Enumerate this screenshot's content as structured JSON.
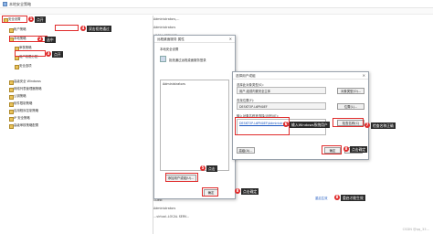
{
  "window": {
    "title": "本地安全策略"
  },
  "tree": {
    "items": [
      "安全设置",
      "帐户策略",
      "本地策略",
      "审核策略",
      "用户权限分配",
      "安全选项",
      "高级安全 Windows",
      "网络列表管理器策略",
      "公钥策略",
      "软件限制策略",
      "应用程序控制策略",
      "IP 安全策略",
      "高级审核策略配置"
    ]
  },
  "policy": {
    "rows": [
      {
        "name": "安全设置",
        "value": "Administrators,..."
      },
      {
        "name": "…",
        "value": "Administrators"
      },
      {
        "name": "…",
        "value": "LOCAL SERVICE,..."
      },
      {
        "name": "…",
        "value": "Administrators,Users"
      },
      {
        "name": "…",
        "value": "Everyone,Administrators"
      },
      {
        "name": "…",
        "value": "LOCAL SERVICE,..."
      },
      {
        "name": "…",
        "value": "Administrators"
      },
      {
        "name": "…",
        "value": "Guest"
      },
      {
        "name": "…",
        "value": "Administrators"
      },
      {
        "name": "…",
        "value": "LOCAL SERVICE,..."
      },
      {
        "name": "…",
        "value": "Administrators"
      },
      {
        "name": "…",
        "value": "Administrators,..."
      },
      {
        "name": "…",
        "value": "LOCAL SERVICE"
      },
      {
        "name": "…",
        "value": "Everyone,Administrators"
      },
      {
        "name": "…",
        "value": "Administrators"
      },
      {
        "name": "…",
        "value": "Guest"
      },
      {
        "name": "…",
        "value": "Administrators"
      },
      {
        "name": "…",
        "value": "LOCAL SERVICE,NE..."
      },
      {
        "name": "…",
        "value": "Everyone,Administrators"
      },
      {
        "name": "…",
        "value": "Administrators"
      },
      {
        "name": "…",
        "value": "LOCAL SERVICE"
      },
      {
        "name": "…",
        "value": "Administrators"
      },
      {
        "name": "…",
        "value": "Guest"
      },
      {
        "name": "…",
        "value": "Administrators"
      },
      {
        "name": "…",
        "value": "…virtual..LOCAL SERV..."
      }
    ]
  },
  "prop_dialog": {
    "title": "远程桌面服务 属性",
    "header": "本地安全设置",
    "policy_name": "拒绝通过远程桌面服务登录",
    "list_item": "Administrators",
    "add_button": "添加用户或组(U)...",
    "ok_button": "确定",
    "cancel_button": "取消",
    "apply_button": "应用"
  },
  "select_dialog": {
    "title": "选择用户或组",
    "object_type_label": "选择此对象类型(S):",
    "object_type_value": "用户,组或内置安全主体",
    "object_type_button": "对象类型(O)...",
    "location_label": "查找位置(F):",
    "location_value": "DESKTOP-L6PN0EF",
    "location_button": "位置(L)...",
    "names_label": "输入对象名称来选择(示例)(E):",
    "names_value": "DESKTOP-L6PN0EF\\Administrators",
    "check_button": "检查名称(C)",
    "advanced_button": "高级(A)...",
    "ok_button": "确定",
    "cancel_button": "取消"
  },
  "annotations": {
    "step1": "1",
    "step2": "2",
    "step3": "3",
    "step4": "4",
    "step5": "5",
    "step6": "6",
    "step7": "7",
    "step8": "8",
    "call1": "点开",
    "call2": "选中",
    "call3": "点开",
    "call4": "双击拒绝通过",
    "call5": "点击",
    "call6": "输入Windows系统用户",
    "call7": "检查名称正确",
    "call8": "点击确定",
    "call9": "点击确定",
    "call10": "重启才能生效",
    "restart_link": "重启生效"
  },
  "watermark": "CSDN @qq_33..."
}
